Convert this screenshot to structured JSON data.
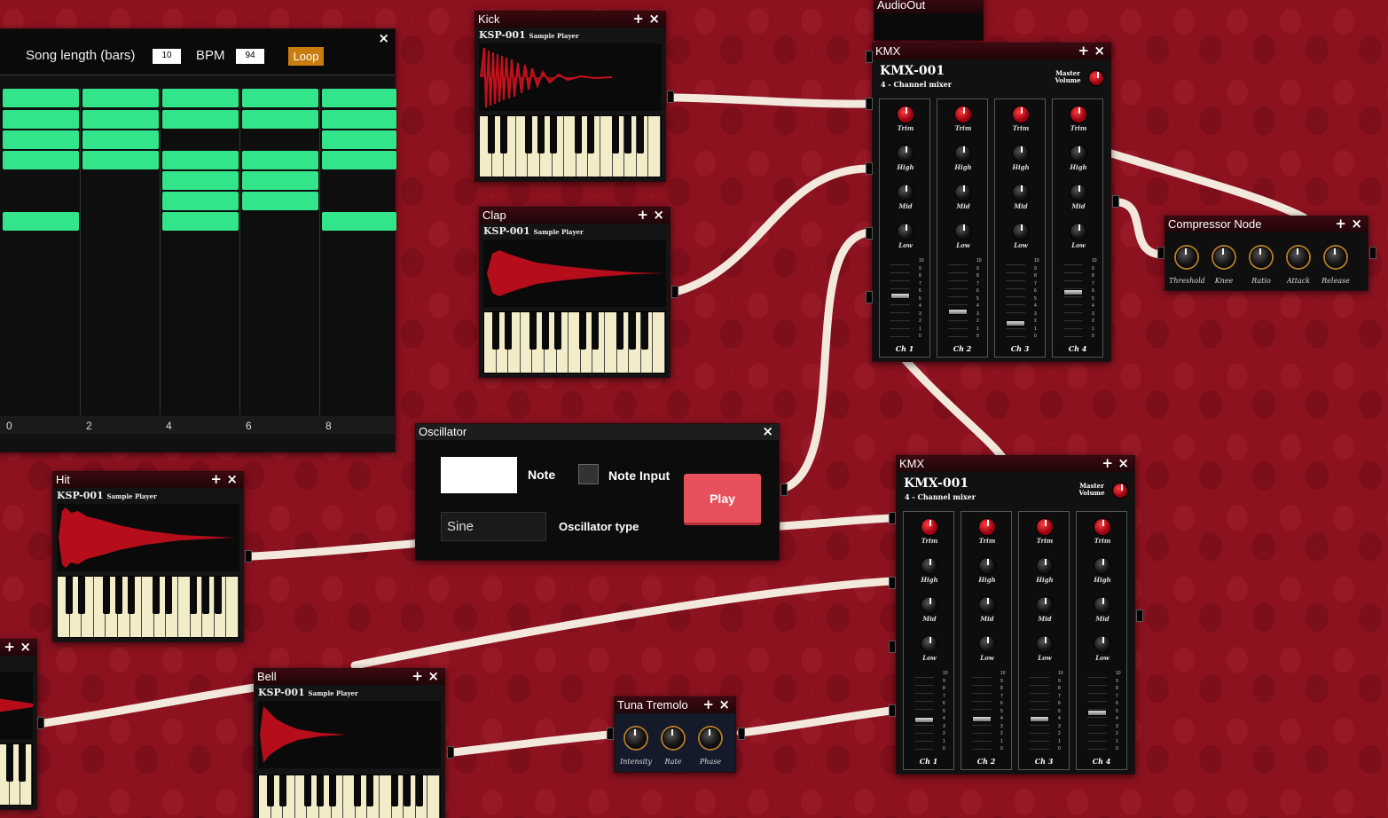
{
  "sequencer": {
    "song_length_label": "Song length (bars)",
    "song_length": "10",
    "bpm_label": "BPM",
    "bpm": "94",
    "loop_label": "Loop",
    "close": "×",
    "ticks": [
      "0",
      "2",
      "4",
      "6",
      "8"
    ]
  },
  "kick": {
    "title": "Kick",
    "plus": "+",
    "close": "×",
    "model": "KSP-001",
    "subtitle": "Sample Player"
  },
  "clap": {
    "title": "Clap",
    "plus": "+",
    "close": "×",
    "model": "KSP-001",
    "subtitle": "Sample Player"
  },
  "hit": {
    "title": "Hit",
    "plus": "+",
    "close": "×",
    "model": "KSP-001",
    "subtitle": "Sample Player"
  },
  "bell": {
    "title": "Bell",
    "plus": "+",
    "close": "×",
    "model": "KSP-001",
    "subtitle": "Sample Player"
  },
  "partial": {
    "plus": "+",
    "close": "×"
  },
  "audio_out": {
    "title": "AudioOut"
  },
  "oscillator": {
    "title": "Oscillator",
    "close": "×",
    "note_label": "Note",
    "note_value": "",
    "note_input_label": "Note Input",
    "play_label": "Play",
    "type_value": "Sine",
    "type_label": "Oscillator type"
  },
  "kmx_top": {
    "title": "KMX",
    "plus": "+",
    "close": "×",
    "model": "KMX-001",
    "subtitle": "4 - Channel mixer",
    "master_label": "Master Volume",
    "knobs": [
      "Trim",
      "High",
      "Mid",
      "Low"
    ],
    "channels": [
      "Ch 1",
      "Ch 2",
      "Ch 3",
      "Ch 4"
    ],
    "fader_levels": [
      0.55,
      0.35,
      0.2,
      0.6
    ]
  },
  "kmx_bottom": {
    "title": "KMX",
    "plus": "+",
    "close": "×",
    "model": "KMX-001",
    "subtitle": "4 - Channel mixer",
    "master_label": "Master Volume",
    "knobs": [
      "Trim",
      "High",
      "Mid",
      "Low"
    ],
    "channels": [
      "Ch 1",
      "Ch 2",
      "Ch 3",
      "Ch 4"
    ],
    "fader_levels": [
      0.4,
      0.42,
      0.42,
      0.5
    ]
  },
  "compressor": {
    "title": "Compressor Node",
    "plus": "+",
    "close": "×",
    "knobs": [
      "Threshold",
      "Knee",
      "Ratio",
      "Attack",
      "Release"
    ]
  },
  "tremolo": {
    "title": "Tuna Tremolo",
    "plus": "+",
    "close": "×",
    "knobs": [
      "Intensity",
      "Rate",
      "Phase"
    ]
  },
  "fader_scale": [
    "10",
    "9",
    "8",
    "7",
    "6",
    "5",
    "4",
    "3",
    "2",
    "1",
    "0"
  ],
  "colors": {
    "background": "#8c1220",
    "wire": "#f2e8dc",
    "grid_cell": "#33e58a",
    "loop": "#c97d10",
    "play": "#e8505b"
  }
}
